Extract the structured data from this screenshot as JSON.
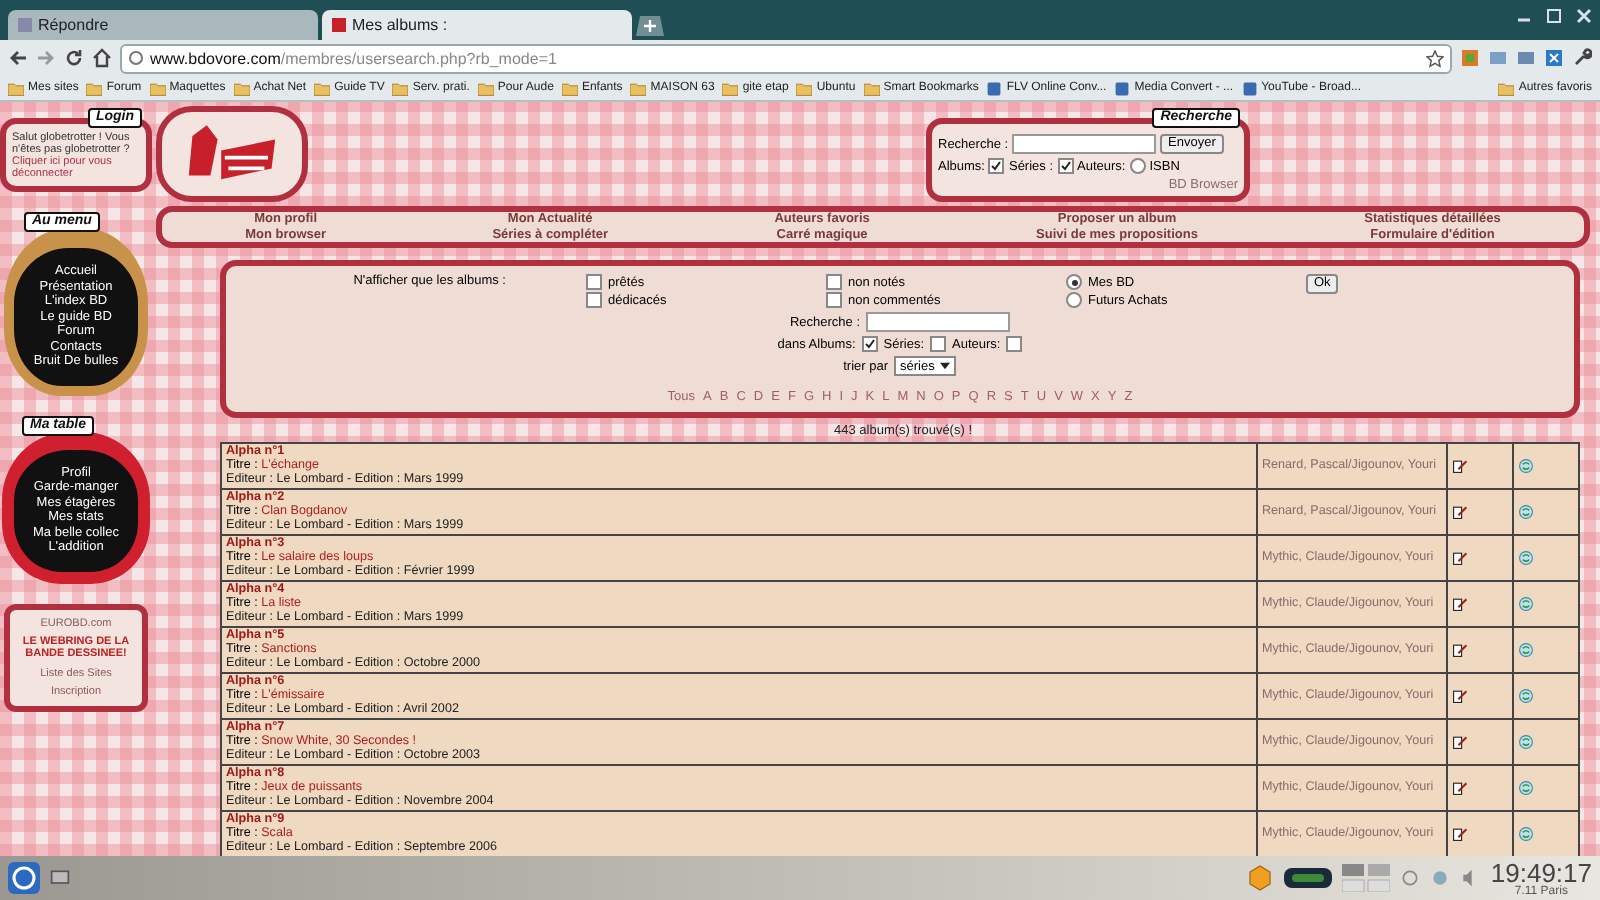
{
  "browser": {
    "tabs": [
      {
        "title": "Répondre",
        "selected": false
      },
      {
        "title": "Mes albums :",
        "selected": true
      }
    ],
    "url_host": "www.bdovore.com",
    "url_path": "/membres/usersearch.php?rb_mode=1",
    "bookmarks": [
      {
        "label": "Mes sites",
        "kind": "folder"
      },
      {
        "label": "Forum",
        "kind": "folder"
      },
      {
        "label": "Maquettes",
        "kind": "folder"
      },
      {
        "label": "Achat Net",
        "kind": "folder"
      },
      {
        "label": "Guide TV",
        "kind": "folder"
      },
      {
        "label": "Serv. prati.",
        "kind": "folder"
      },
      {
        "label": "Pour Aude",
        "kind": "folder"
      },
      {
        "label": "Enfants",
        "kind": "folder"
      },
      {
        "label": "MAISON 63",
        "kind": "folder"
      },
      {
        "label": "gite etap",
        "kind": "folder"
      },
      {
        "label": "Ubuntu",
        "kind": "folder"
      },
      {
        "label": "Smart Bookmarks",
        "kind": "folder"
      },
      {
        "label": "FLV Online Conv...",
        "kind": "page"
      },
      {
        "label": "Media Convert - ...",
        "kind": "page"
      },
      {
        "label": "YouTube - Broad...",
        "kind": "page"
      }
    ],
    "other_bookmarks": "Autres favoris"
  },
  "login": {
    "title": "Login",
    "text": "Salut globetrotter ! Vous n'êtes pas globetrotter ?",
    "link": "Cliquer ici pour vous déconnecter"
  },
  "menu": {
    "title": "Au menu",
    "items": [
      "Accueil",
      "Présentation",
      "L'index BD",
      "Le guide BD",
      "Forum",
      "Contacts",
      "Bruit De bulles"
    ]
  },
  "table_menu": {
    "title": "Ma table",
    "items": [
      "Profil",
      "Garde-manger",
      "Mes étagères",
      "Mes stats",
      "Ma belle collec",
      "L'addition"
    ]
  },
  "webring": {
    "site": "EUROBD.com",
    "title": "LE WEBRING DE LA BANDE DESSINEE!",
    "links": [
      "Liste des Sites",
      "Inscription"
    ]
  },
  "search": {
    "title": "Recherche",
    "label": "Recherche :",
    "button": "Envoyer",
    "albums_label": "Albums:",
    "options": [
      {
        "label": "Séries :",
        "kind": "checkbox",
        "checked": true
      },
      {
        "label": "Auteurs:",
        "kind": "checkbox",
        "checked": true
      },
      {
        "label": "ISBN",
        "kind": "radio",
        "checked": false
      }
    ],
    "link": "BD Browser"
  },
  "nav": [
    {
      "links": [
        "Mon profil",
        "Mon browser"
      ]
    },
    {
      "links": [
        "Mon Actualité",
        "Séries à compléter"
      ]
    },
    {
      "links": [
        "Auteurs favoris",
        "Carré magique"
      ]
    },
    {
      "links": [
        "Proposer un album",
        "Suivi de mes propositions"
      ]
    },
    {
      "links": [
        "Statistiques détaillées",
        "Formulaire d'édition"
      ]
    }
  ],
  "filters": {
    "label": "N'afficher que les albums :",
    "checkbox_columns": [
      [
        {
          "label": "prêtés",
          "checked": false
        },
        {
          "label": "dédicacés",
          "checked": false
        }
      ],
      [
        {
          "label": "non notés",
          "checked": false
        },
        {
          "label": "non commentés",
          "checked": false
        }
      ]
    ],
    "radios": [
      {
        "label": "Mes BD",
        "selected": true
      },
      {
        "label": "Futurs Achats",
        "selected": false
      }
    ],
    "ok": "Ok",
    "search_label": "Recherche :",
    "in_label": "dans Albums:",
    "in_options": [
      {
        "label": "Séries:",
        "checked": true
      },
      {
        "label": "Auteurs:",
        "checked": false
      },
      {
        "checked": false
      }
    ],
    "sort_label": "trier par",
    "sort_value": "séries",
    "letters": [
      "Tous",
      "A",
      "B",
      "C",
      "D",
      "E",
      "F",
      "G",
      "H",
      "I",
      "J",
      "K",
      "L",
      "M",
      "N",
      "O",
      "P",
      "Q",
      "R",
      "S",
      "T",
      "U",
      "V",
      "W",
      "X",
      "Y",
      "Z"
    ]
  },
  "count": "443 album(s) trouvé(s) !",
  "albums": [
    {
      "series": "Alpha n°1",
      "title_label": "Titre :",
      "title": "L'échange",
      "publisher": "Editeur : Le Lombard - Edition : Mars 1999",
      "authors": "Renard, Pascal/Jigounov, Youri"
    },
    {
      "series": "Alpha n°2",
      "title_label": "Titre :",
      "title": "Clan Bogdanov",
      "publisher": "Editeur : Le Lombard - Edition : Mars 1999",
      "authors": "Renard, Pascal/Jigounov, Youri"
    },
    {
      "series": "Alpha n°3",
      "title_label": "Titre :",
      "title": "Le salaire des loups",
      "publisher": "Editeur : Le Lombard - Edition : Février 1999",
      "authors": "Mythic, Claude/Jigounov, Youri"
    },
    {
      "series": "Alpha n°4",
      "title_label": "Titre :",
      "title": "La liste",
      "publisher": "Editeur : Le Lombard - Edition : Mars 1999",
      "authors": "Mythic, Claude/Jigounov, Youri"
    },
    {
      "series": "Alpha n°5",
      "title_label": "Titre :",
      "title": "Sanctions",
      "publisher": "Editeur : Le Lombard - Edition : Octobre 2000",
      "authors": "Mythic, Claude/Jigounov, Youri"
    },
    {
      "series": "Alpha n°6",
      "title_label": "Titre :",
      "title": "L'émissaire",
      "publisher": "Editeur : Le Lombard - Edition : Avril 2002",
      "authors": "Mythic, Claude/Jigounov, Youri"
    },
    {
      "series": "Alpha n°7",
      "title_label": "Titre :",
      "title": "Snow White, 30 Secondes !",
      "publisher": "Editeur : Le Lombard - Edition : Octobre 2003",
      "authors": "Mythic, Claude/Jigounov, Youri"
    },
    {
      "series": "Alpha n°8",
      "title_label": "Titre :",
      "title": "Jeux de puissants",
      "publisher": "Editeur : Le Lombard - Edition : Novembre 2004",
      "authors": "Mythic, Claude/Jigounov, Youri"
    },
    {
      "series": "Alpha n°9",
      "title_label": "Titre :",
      "title": "Scala",
      "publisher": "Editeur : Le Lombard - Edition : Septembre 2006",
      "authors": "Mythic, Claude/Jigounov, Youri"
    }
  ],
  "taskbar": {
    "clock": "19:49:17",
    "date": "7.11 Paris"
  }
}
